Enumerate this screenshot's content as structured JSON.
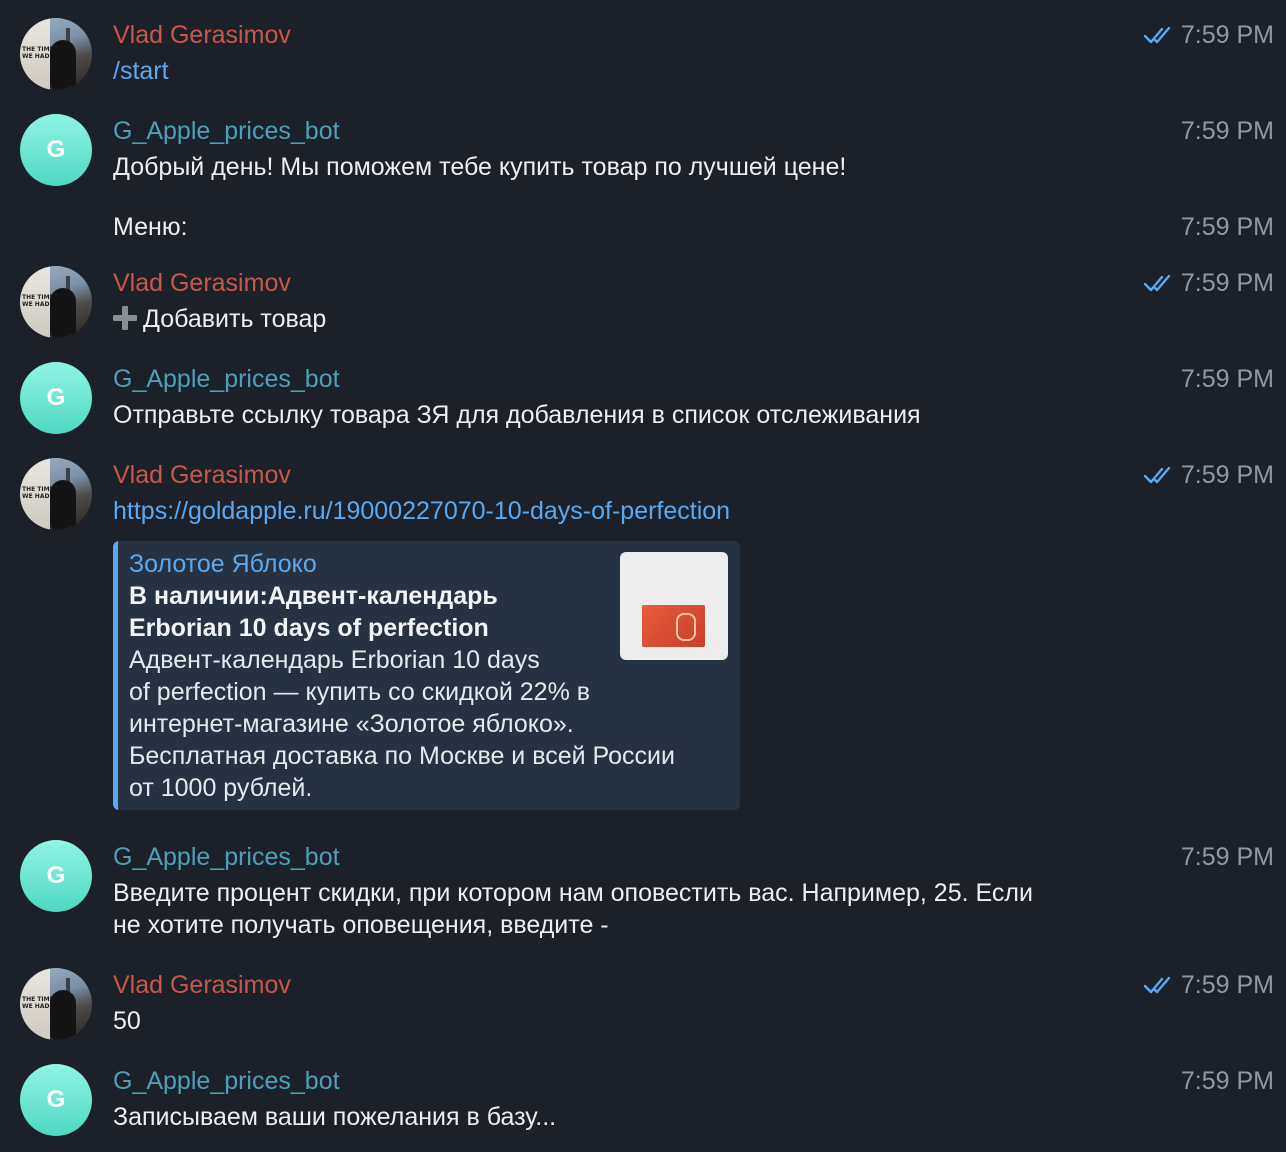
{
  "colors": {
    "background": "#1c2129",
    "user_name": "#c8574b",
    "bot_name": "#4f9fb8",
    "link": "#5aa9f0",
    "read_check": "#5aa9f0",
    "time": "#8e99a4",
    "preview_bg": "#263241"
  },
  "messages": [
    {
      "sender": "Vlad Gerasimov",
      "text": "/start",
      "time": "7:59 PM",
      "read": true,
      "avatar": "user-photo"
    },
    {
      "sender": "G_Apple_prices_bot",
      "avatar_letter": "G",
      "text": "Добрый день! Мы поможем тебе купить товар по лучшей цене!",
      "time": "7:59 PM"
    },
    {
      "text": "Меню:",
      "time": "7:59 PM"
    },
    {
      "sender": "Vlad Gerasimov",
      "icon": "plus-icon",
      "text": "Добавить товар",
      "time": "7:59 PM",
      "read": true,
      "avatar": "user-photo"
    },
    {
      "sender": "G_Apple_prices_bot",
      "avatar_letter": "G",
      "text": "Отправьте ссылку товара ЗЯ для добавления в список отслеживания",
      "time": "7:59 PM"
    },
    {
      "sender": "Vlad Gerasimov",
      "text": "https://goldapple.ru/19000227070-10-days-of-perfection",
      "time": "7:59 PM",
      "read": true,
      "avatar": "user-photo",
      "preview": {
        "site": "Золотое Яблоко",
        "title_line1": "В наличии:Адвент-календарь",
        "title_line2": "Erborian 10 days of perfection",
        "desc_line1": "Адвент-календарь  Erborian 10 days",
        "desc_line2": "of perfection   — купить со скидкой 22% в",
        "desc_line3": "интернет-магазине «Золотое яблоко».",
        "desc_line4": "Бесплатная доставка по Москве и всей России",
        "desc_line5": "от 1000 рублей."
      }
    },
    {
      "sender": "G_Apple_prices_bot",
      "avatar_letter": "G",
      "text_line1": "Введите процент скидки, при котором нам оповестить вас. Например, 25. Если",
      "text_line2": "не хотите получать оповещения, введите -",
      "time": "7:59 PM"
    },
    {
      "sender": "Vlad Gerasimov",
      "text": "50",
      "time": "7:59 PM",
      "read": true,
      "avatar": "user-photo"
    },
    {
      "sender": "G_Apple_prices_bot",
      "avatar_letter": "G",
      "text": "Записываем ваши пожелания в базу...",
      "time": "7:59 PM"
    }
  ]
}
